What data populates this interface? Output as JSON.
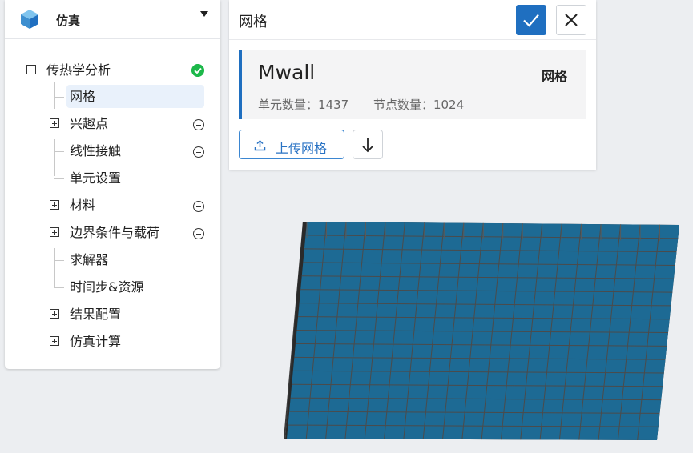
{
  "app": {
    "title": "仿真"
  },
  "tree": {
    "root": {
      "label": "传热学分析",
      "status": "complete"
    },
    "items": [
      {
        "label": "网格",
        "selected": true
      },
      {
        "label": "兴趣点"
      },
      {
        "label": "线性接触"
      },
      {
        "label": "单元设置"
      },
      {
        "label": "材料"
      },
      {
        "label": "边界条件与载荷"
      },
      {
        "label": "求解器"
      },
      {
        "label": "时间步&资源"
      },
      {
        "label": "结果配置"
      },
      {
        "label": "仿真计算"
      }
    ]
  },
  "panel": {
    "title": "网格",
    "mesh": {
      "name": "Mwall",
      "type_label": "网格",
      "element_count_label": "单元数量：1437",
      "node_count_label": "节点数量：1024"
    },
    "upload_label": "上传网格"
  },
  "colors": {
    "accent": "#1f6fc0",
    "mesh_fill": "#1d6a94",
    "mesh_edge": "#4a4a4a",
    "success": "#1db84a"
  },
  "icons": [
    "cube-logo-icon",
    "caret-down-icon",
    "check-icon",
    "close-icon",
    "upload-icon",
    "download-arrow-icon",
    "add-circle-icon",
    "expand-icon",
    "collapse-icon"
  ]
}
